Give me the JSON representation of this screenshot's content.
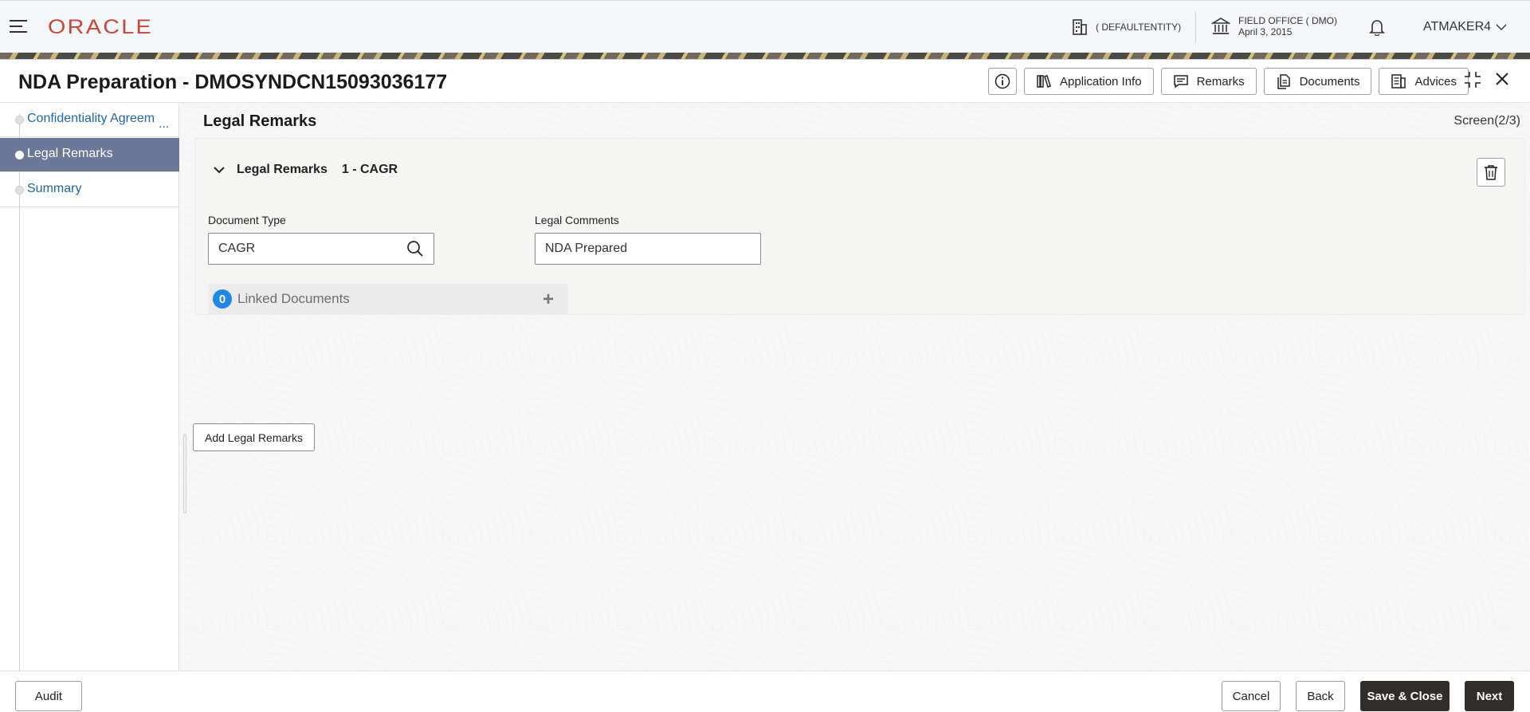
{
  "topbar": {
    "logo": "ORACLE",
    "entity": "( DEFAULTENTITY)",
    "office_name": "FIELD OFFICE ( DMO)",
    "office_date": "April 3, 2015",
    "user": "ATMAKER4"
  },
  "window": {
    "title": "NDA Preparation - DMOSYNDCN15093036177",
    "buttons": {
      "application_info": "Application Info",
      "remarks": "Remarks",
      "documents": "Documents",
      "advices": "Advices"
    }
  },
  "sidebar": {
    "items": [
      {
        "label": "Confidentiality Agreem",
        "active": false
      },
      {
        "label": "Legal Remarks",
        "active": true
      },
      {
        "label": "Summary",
        "active": false
      }
    ],
    "ellipsis": "..."
  },
  "main": {
    "section_title": "Legal Remarks",
    "screen_indicator": "Screen(2/3)",
    "card": {
      "title": "Legal Remarks",
      "subtitle": "1 - CAGR",
      "document_type_label": "Document Type",
      "document_type_value": "CAGR",
      "legal_comments_label": "Legal Comments",
      "legal_comments_value": "NDA Prepared",
      "linked_count": "0",
      "linked_label": "Linked Documents",
      "plus": "+"
    },
    "add_button": "Add Legal Remarks"
  },
  "footer": {
    "audit": "Audit",
    "cancel": "Cancel",
    "back": "Back",
    "save_close": "Save & Close",
    "next": "Next"
  },
  "colors": {
    "brand": "#c74634",
    "sidebar_active": "#6b7897",
    "link": "#1f66a3",
    "badge": "#1e88e5",
    "primary_button": "#312d2a"
  }
}
